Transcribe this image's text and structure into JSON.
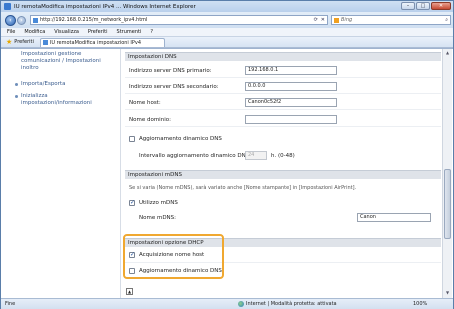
{
  "window": {
    "title": "IU remotaModifica impostazioni IPv4 ...     Windows Internet Explorer",
    "controls": {
      "minimize": "–",
      "maximize": "□",
      "close": "✕"
    }
  },
  "address_bar": {
    "url": "http://192.168.0.215/m_network_ipv4.html",
    "refresh_icon": "⟳",
    "stop_icon": "✕",
    "search_placeholder": "Bing",
    "search_icon": "⌕"
  },
  "menu": [
    "File",
    "Modifica",
    "Visualizza",
    "Preferiti",
    "Strumenti",
    "?"
  ],
  "favorites": {
    "label": "Preferiti",
    "tab_title": "IU remotaModifica impostazioni IPv4"
  },
  "sidebar": {
    "items": [
      {
        "label": "Impostazioni gestione comunicazioni / Impostazioni inoltro"
      },
      {
        "label": "Importa/Esporta"
      },
      {
        "label": "Inizializza impostazioni/informazioni"
      }
    ]
  },
  "dns": {
    "header": "Impostazioni DNS",
    "primary_label": "Indirizzo server DNS primario:",
    "primary_value": "192.168.0.1",
    "secondary_label": "Indirizzo server DNS secondario:",
    "secondary_value": "0.0.0.0",
    "host_label": "Nome host:",
    "host_value": "Canon0c52f2",
    "domain_label": "Nome dominio:",
    "domain_value": "",
    "dynamic_update_label": "Aggiornamento dinamico DNS",
    "interval_label": "Intervallo aggiornamento dinamico DNS:",
    "interval_value": "24",
    "interval_unit": "h. (0-48)"
  },
  "mdns": {
    "header": "Impostazioni mDNS",
    "note": "Se si varia (Nome mDNS), sarà variato anche [Nome stampante] in [Impostazioni AirPrint].",
    "use_label": "Utilizzo mDNS",
    "name_label": "Nome mDNS:",
    "name_value": "Canon"
  },
  "dhcp": {
    "header": "Impostazioni opzione DHCP",
    "hostname_label": "Acquisizione nome host",
    "dynamic_label": "Aggiornamento dinamico DNS"
  },
  "status": {
    "left": "Fine",
    "zone": "Internet | Modalità protetta: attivata",
    "zoom": "100%"
  }
}
